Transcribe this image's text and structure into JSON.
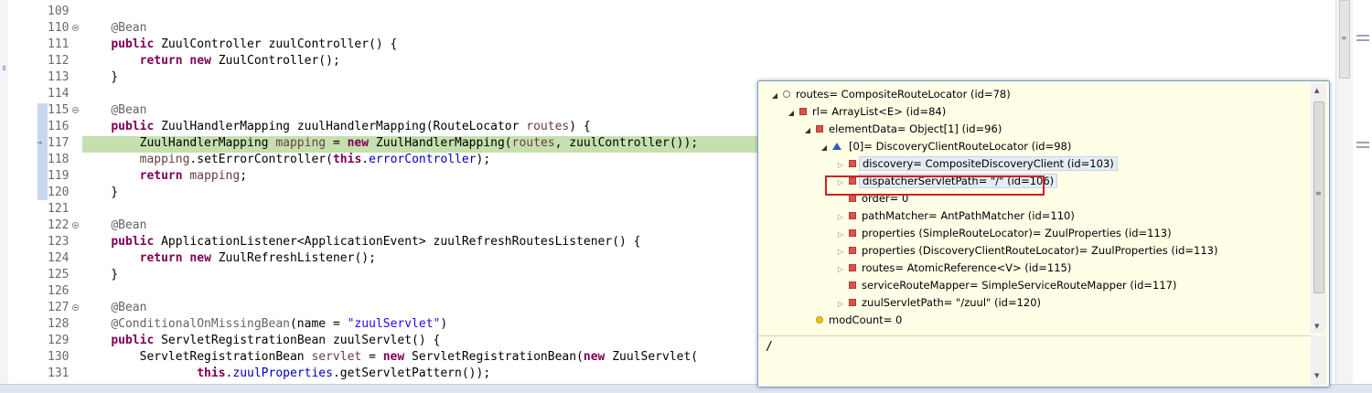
{
  "editor": {
    "lines": [
      {
        "num": "109",
        "fold": false,
        "tokens": []
      },
      {
        "num": "110",
        "fold": true,
        "tokens": [
          {
            "t": "    "
          },
          {
            "t": "@Bean",
            "c": "ann"
          }
        ]
      },
      {
        "num": "111",
        "fold": false,
        "tokens": [
          {
            "t": "    "
          },
          {
            "t": "public",
            "c": "kw"
          },
          {
            "t": " ZuulController zuulController() {"
          }
        ]
      },
      {
        "num": "112",
        "fold": false,
        "tokens": [
          {
            "t": "        "
          },
          {
            "t": "return",
            "c": "kw"
          },
          {
            "t": " "
          },
          {
            "t": "new",
            "c": "kw"
          },
          {
            "t": " ZuulController();"
          }
        ]
      },
      {
        "num": "113",
        "fold": false,
        "tokens": [
          {
            "t": "    }"
          }
        ]
      },
      {
        "num": "114",
        "fold": false,
        "tokens": []
      },
      {
        "num": "115",
        "fold": true,
        "tokens": [
          {
            "t": "    "
          },
          {
            "t": "@Bean",
            "c": "ann"
          }
        ]
      },
      {
        "num": "116",
        "fold": false,
        "tokens": [
          {
            "t": "    "
          },
          {
            "t": "public",
            "c": "kw"
          },
          {
            "t": " ZuulHandlerMapping zuulHandlerMapping(RouteLocator "
          },
          {
            "t": "routes",
            "c": "var"
          },
          {
            "t": ") {"
          }
        ]
      },
      {
        "num": "117",
        "fold": false,
        "tokens": [
          {
            "t": "        ZuulHandlerMapping "
          },
          {
            "t": "mapping",
            "c": "var"
          },
          {
            "t": " = "
          },
          {
            "t": "new",
            "c": "kw"
          },
          {
            "t": " ZuulHandlerMapping("
          },
          {
            "t": "routes",
            "c": "var"
          },
          {
            "t": ", zuulController());"
          }
        ]
      },
      {
        "num": "118",
        "fold": false,
        "tokens": [
          {
            "t": "        "
          },
          {
            "t": "mapping",
            "c": "var"
          },
          {
            "t": ".setErrorController("
          },
          {
            "t": "this",
            "c": "kw"
          },
          {
            "t": "."
          },
          {
            "t": "errorController",
            "c": "fld"
          },
          {
            "t": ");"
          }
        ]
      },
      {
        "num": "119",
        "fold": false,
        "tokens": [
          {
            "t": "        "
          },
          {
            "t": "return",
            "c": "kw"
          },
          {
            "t": " "
          },
          {
            "t": "mapping",
            "c": "var"
          },
          {
            "t": ";"
          }
        ]
      },
      {
        "num": "120",
        "fold": false,
        "tokens": [
          {
            "t": "    }"
          }
        ]
      },
      {
        "num": "121",
        "fold": false,
        "tokens": []
      },
      {
        "num": "122",
        "fold": true,
        "tokens": [
          {
            "t": "    "
          },
          {
            "t": "@Bean",
            "c": "ann"
          }
        ]
      },
      {
        "num": "123",
        "fold": false,
        "tokens": [
          {
            "t": "    "
          },
          {
            "t": "public",
            "c": "kw"
          },
          {
            "t": " ApplicationListener<ApplicationEvent> zuulRefreshRoutesListener() {"
          }
        ]
      },
      {
        "num": "124",
        "fold": false,
        "tokens": [
          {
            "t": "        "
          },
          {
            "t": "return",
            "c": "kw"
          },
          {
            "t": " "
          },
          {
            "t": "new",
            "c": "kw"
          },
          {
            "t": " ZuulRefreshListener();"
          }
        ]
      },
      {
        "num": "125",
        "fold": false,
        "tokens": [
          {
            "t": "    }"
          }
        ]
      },
      {
        "num": "126",
        "fold": false,
        "tokens": []
      },
      {
        "num": "127",
        "fold": true,
        "tokens": [
          {
            "t": "    "
          },
          {
            "t": "@Bean",
            "c": "ann"
          }
        ]
      },
      {
        "num": "128",
        "fold": false,
        "tokens": [
          {
            "t": "    "
          },
          {
            "t": "@ConditionalOnMissingBean",
            "c": "ann"
          },
          {
            "t": "(name = "
          },
          {
            "t": "\"zuulServlet\"",
            "c": "str"
          },
          {
            "t": ")"
          }
        ]
      },
      {
        "num": "129",
        "fold": false,
        "tokens": [
          {
            "t": "    "
          },
          {
            "t": "public",
            "c": "kw"
          },
          {
            "t": " ServletRegistrationBean zuulServlet() {"
          }
        ]
      },
      {
        "num": "130",
        "fold": false,
        "tokens": [
          {
            "t": "        ServletRegistrationBean "
          },
          {
            "t": "servlet",
            "c": "var"
          },
          {
            "t": " = "
          },
          {
            "t": "new",
            "c": "kw"
          },
          {
            "t": " ServletRegistrationBean("
          },
          {
            "t": "new",
            "c": "kw"
          },
          {
            "t": " ZuulServlet("
          }
        ]
      },
      {
        "num": "131",
        "fold": false,
        "tokens": [
          {
            "t": "                "
          },
          {
            "t": "this",
            "c": "kw"
          },
          {
            "t": "."
          },
          {
            "t": "zuulProperties",
            "c": "fld"
          },
          {
            "t": ".getServletPattern());"
          }
        ]
      }
    ]
  },
  "inspector": {
    "rows": [
      {
        "indent": 0,
        "twisty": "open",
        "icon": "circ",
        "text": "routes= CompositeRouteLocator  (id=78)"
      },
      {
        "indent": 1,
        "twisty": "open",
        "icon": "red",
        "text": "rl= ArrayList<E>  (id=84)"
      },
      {
        "indent": 2,
        "twisty": "open",
        "icon": "red",
        "text": "elementData= Object[1]  (id=96)"
      },
      {
        "indent": 3,
        "twisty": "open",
        "icon": "tri",
        "text": "[0]= DiscoveryClientRouteLocator  (id=98)"
      },
      {
        "indent": 4,
        "twisty": "closed",
        "icon": "red",
        "text": "discovery= CompositeDiscoveryClient  (id=103)",
        "sel": true
      },
      {
        "indent": 4,
        "twisty": "closed",
        "icon": "red",
        "text": "dispatcherServletPath= \"/\" (id=106)",
        "sel": true
      },
      {
        "indent": 4,
        "twisty": "none",
        "icon": "red",
        "text": "order= 0"
      },
      {
        "indent": 4,
        "twisty": "closed",
        "icon": "red",
        "text": "pathMatcher= AntPathMatcher  (id=110)"
      },
      {
        "indent": 4,
        "twisty": "closed",
        "icon": "red",
        "text": "properties (SimpleRouteLocator)= ZuulProperties  (id=113)"
      },
      {
        "indent": 4,
        "twisty": "closed",
        "icon": "red",
        "text": "properties (DiscoveryClientRouteLocator)= ZuulProperties  (id=113)"
      },
      {
        "indent": 4,
        "twisty": "closed",
        "icon": "red",
        "text": "routes= AtomicReference<V>  (id=115)"
      },
      {
        "indent": 4,
        "twisty": "none",
        "icon": "red",
        "text": "serviceRouteMapper= SimpleServiceRouteMapper  (id=117)"
      },
      {
        "indent": 4,
        "twisty": "closed",
        "icon": "red",
        "text": "zuulServletPath= \"/zuul\" (id=120)"
      },
      {
        "indent": 2,
        "twisty": "none",
        "icon": "yel",
        "text": "modCount= 0"
      }
    ],
    "detail_value": "/"
  }
}
